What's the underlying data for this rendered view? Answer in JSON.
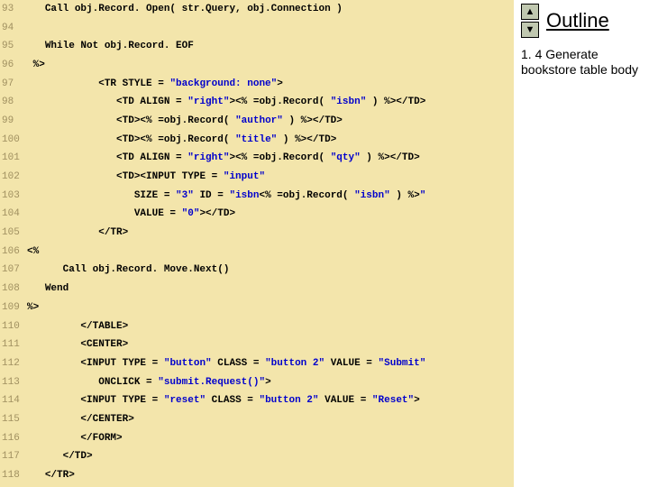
{
  "right": {
    "title": "Outline",
    "item": "1. 4 Generate bookstore table body"
  },
  "lines": [
    {
      "n": "93",
      "pre": "   ",
      "segs": [
        {
          "t": "Call obj.Record. Open( str.Query, obj.Connection )"
        }
      ]
    },
    {
      "n": "94",
      "pre": "",
      "segs": []
    },
    {
      "n": "95",
      "pre": "   ",
      "segs": [
        {
          "t": "While Not obj.Record. EOF"
        }
      ]
    },
    {
      "n": "96",
      "pre": " ",
      "segs": [
        {
          "t": "%>"
        }
      ]
    },
    {
      "n": "97",
      "pre": "            ",
      "segs": [
        {
          "t": "<TR STYLE = "
        },
        {
          "t": "\"background: none\"",
          "c": "str"
        },
        {
          "t": ">"
        }
      ]
    },
    {
      "n": "98",
      "pre": "               ",
      "segs": [
        {
          "t": "<TD ALIGN = "
        },
        {
          "t": "\"right\"",
          "c": "str"
        },
        {
          "t": "><% =obj.Record( "
        },
        {
          "t": "\"isbn\"",
          "c": "str"
        },
        {
          "t": " ) %></TD>"
        }
      ]
    },
    {
      "n": "99",
      "pre": "               ",
      "segs": [
        {
          "t": "<TD><% =obj.Record( "
        },
        {
          "t": "\"author\"",
          "c": "str"
        },
        {
          "t": " ) %></TD>"
        }
      ]
    },
    {
      "n": "100",
      "pre": "               ",
      "segs": [
        {
          "t": "<TD><% =obj.Record( "
        },
        {
          "t": "\"title\"",
          "c": "str"
        },
        {
          "t": " ) %></TD>"
        }
      ]
    },
    {
      "n": "101",
      "pre": "               ",
      "segs": [
        {
          "t": "<TD ALIGN = "
        },
        {
          "t": "\"right\"",
          "c": "str"
        },
        {
          "t": "><% =obj.Record( "
        },
        {
          "t": "\"qty\"",
          "c": "str"
        },
        {
          "t": " ) %></TD>"
        }
      ]
    },
    {
      "n": "102",
      "pre": "               ",
      "segs": [
        {
          "t": "<TD><INPUT TYPE = "
        },
        {
          "t": "\"input\"",
          "c": "str"
        }
      ]
    },
    {
      "n": "103",
      "pre": "                  ",
      "segs": [
        {
          "t": "SIZE = "
        },
        {
          "t": "\"3\"",
          "c": "str"
        },
        {
          "t": " ID = "
        },
        {
          "t": "\"isbn",
          "c": "str"
        },
        {
          "t": "<% =obj.Record( "
        },
        {
          "t": "\"isbn\"",
          "c": "str"
        },
        {
          "t": " ) %>"
        },
        {
          "t": "\"",
          "c": "str"
        }
      ]
    },
    {
      "n": "104",
      "pre": "                  ",
      "segs": [
        {
          "t": "VALUE = "
        },
        {
          "t": "\"0\"",
          "c": "str"
        },
        {
          "t": "></TD>"
        }
      ]
    },
    {
      "n": "105",
      "pre": "            ",
      "segs": [
        {
          "t": "</TR>"
        }
      ]
    },
    {
      "n": "106",
      "pre": "",
      "segs": [
        {
          "t": "<%"
        }
      ]
    },
    {
      "n": "107",
      "pre": "      ",
      "segs": [
        {
          "t": "Call obj.Record. Move.Next()"
        }
      ]
    },
    {
      "n": "108",
      "pre": "   ",
      "segs": [
        {
          "t": "Wend"
        }
      ]
    },
    {
      "n": "109",
      "pre": "",
      "segs": [
        {
          "t": "%>"
        }
      ]
    },
    {
      "n": "110",
      "pre": "         ",
      "segs": [
        {
          "t": "</TABLE>"
        }
      ]
    },
    {
      "n": "111",
      "pre": "         ",
      "segs": [
        {
          "t": "<CENTER>"
        }
      ]
    },
    {
      "n": "112",
      "pre": "         ",
      "segs": [
        {
          "t": "<INPUT TYPE = "
        },
        {
          "t": "\"button\"",
          "c": "str"
        },
        {
          "t": " CLASS = "
        },
        {
          "t": "\"button 2\"",
          "c": "str"
        },
        {
          "t": " VALUE = "
        },
        {
          "t": "\"Submit\"",
          "c": "str"
        }
      ]
    },
    {
      "n": "113",
      "pre": "            ",
      "segs": [
        {
          "t": "ONCLICK = "
        },
        {
          "t": "\"submit.Request()\"",
          "c": "str"
        },
        {
          "t": ">"
        }
      ]
    },
    {
      "n": "114",
      "pre": "         ",
      "segs": [
        {
          "t": "<INPUT TYPE = "
        },
        {
          "t": "\"reset\"",
          "c": "str"
        },
        {
          "t": " CLASS = "
        },
        {
          "t": "\"button 2\"",
          "c": "str"
        },
        {
          "t": " VALUE = "
        },
        {
          "t": "\"Reset\"",
          "c": "str"
        },
        {
          "t": ">"
        }
      ]
    },
    {
      "n": "115",
      "pre": "         ",
      "segs": [
        {
          "t": "</CENTER>"
        }
      ]
    },
    {
      "n": "116",
      "pre": "         ",
      "segs": [
        {
          "t": "</FORM>"
        }
      ]
    },
    {
      "n": "117",
      "pre": "      ",
      "segs": [
        {
          "t": "</TD>"
        }
      ]
    },
    {
      "n": "118",
      "pre": "   ",
      "segs": [
        {
          "t": "</TR>"
        }
      ]
    }
  ]
}
